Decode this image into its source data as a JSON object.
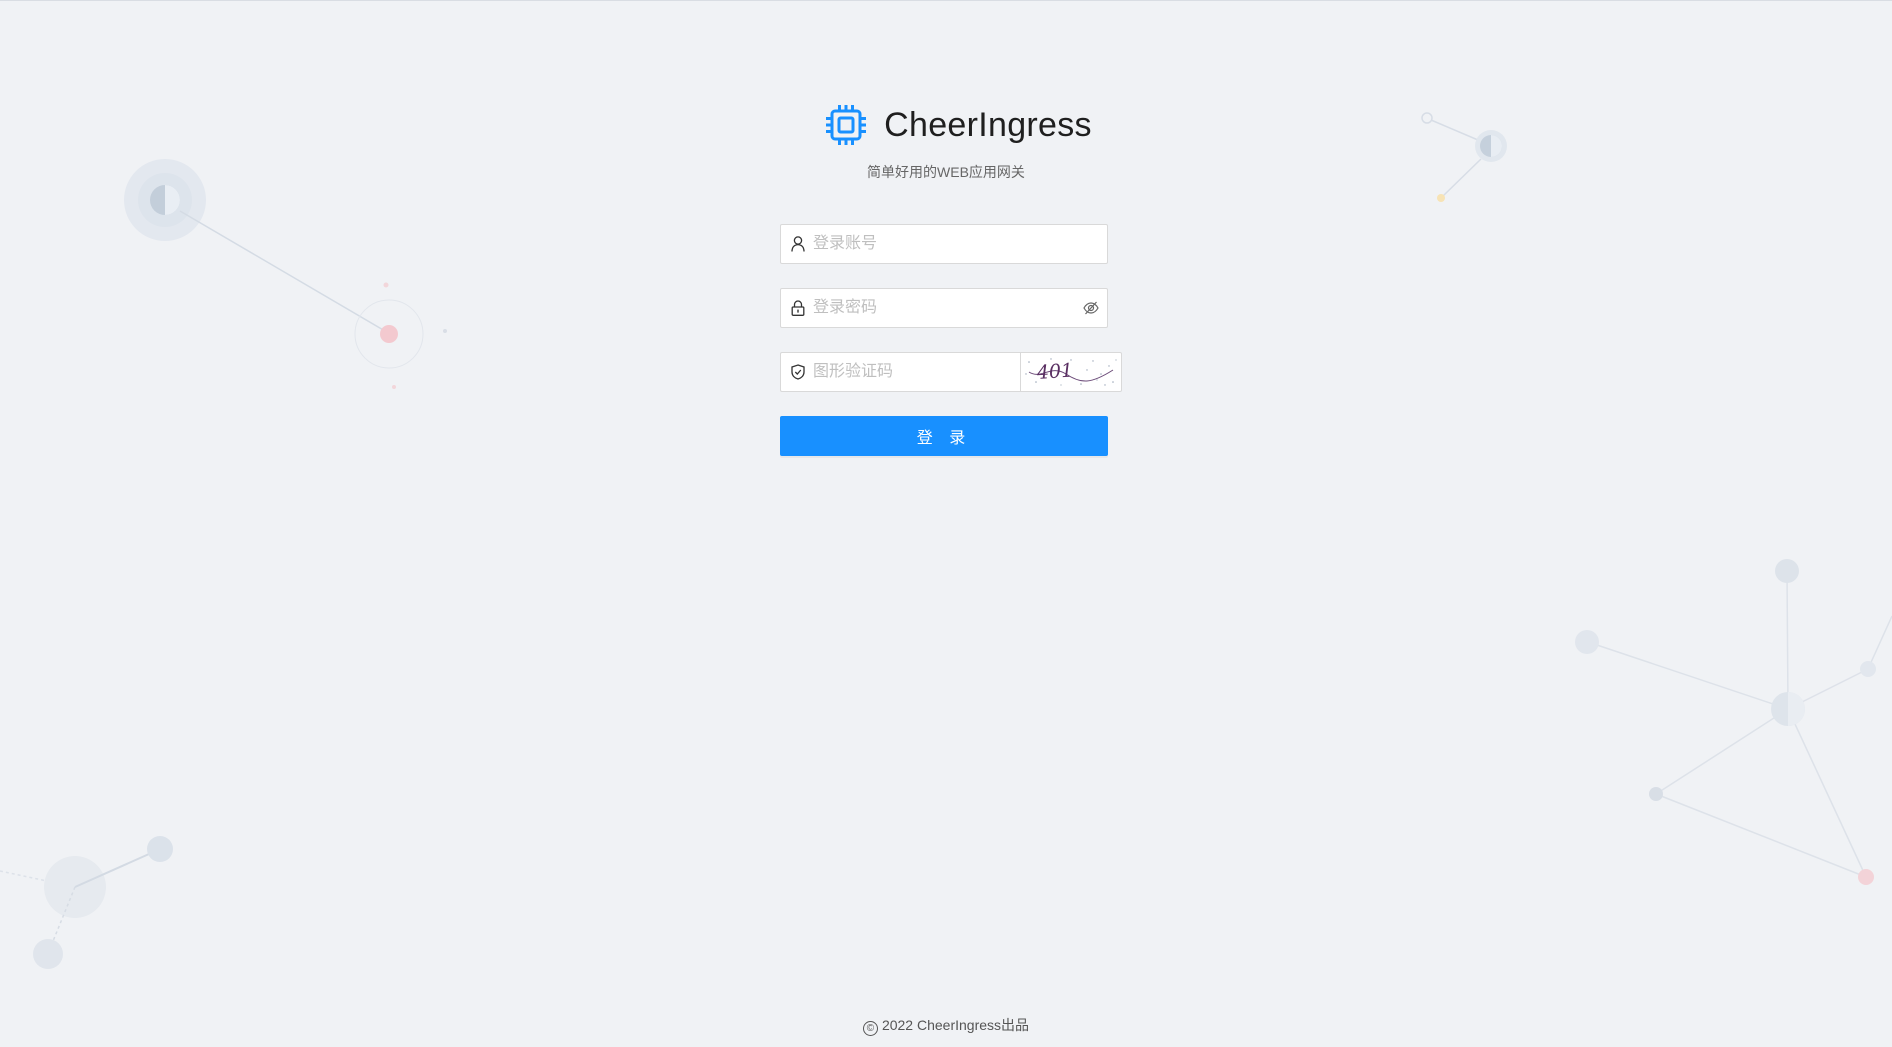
{
  "brand": {
    "title": "CheerIngress",
    "subtitle": "简单好用的WEB应用网关",
    "logo_icon": "cpu-chip-icon",
    "accent_color": "#1890ff"
  },
  "form": {
    "username": {
      "placeholder": "登录账号",
      "value": "",
      "icon": "user-icon"
    },
    "password": {
      "placeholder": "登录密码",
      "value": "",
      "icon": "lock-icon",
      "toggle_icon": "eye-invisible-icon"
    },
    "captcha": {
      "placeholder": "图形验证码",
      "value": "",
      "icon": "shield-check-icon",
      "image_text": "401"
    },
    "submit_label": "登 录"
  },
  "footer": {
    "copyright_symbol": "©",
    "text": "2022 CheerIngress出品"
  }
}
